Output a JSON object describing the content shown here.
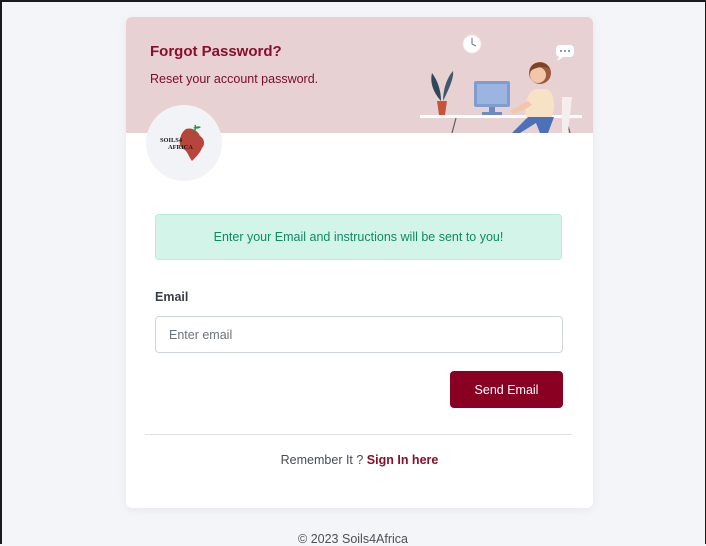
{
  "header": {
    "title": "Forgot Password?",
    "subtitle": "Reset your account password."
  },
  "logo": {
    "text_line1": "SOILS4",
    "text_line2": "AFRICA"
  },
  "alert": {
    "message": "Enter your Email and instructions will be sent to you!"
  },
  "form": {
    "email_label": "Email",
    "email_placeholder": "Enter email",
    "email_value": "",
    "submit_label": "Send Email"
  },
  "signin": {
    "prompt": "Remember It ? ",
    "link_label": "Sign In here"
  },
  "footer": {
    "copyright": "© 2023 Soils4Africa"
  },
  "colors": {
    "brand": "#8a0023",
    "header_bg": "#e8d1d2",
    "alert_bg": "#d3f5e9",
    "alert_text": "#0e8b60"
  },
  "icons": {
    "header_illustration": "person-at-desk-illustration",
    "logo": "soils4africa-logo"
  }
}
